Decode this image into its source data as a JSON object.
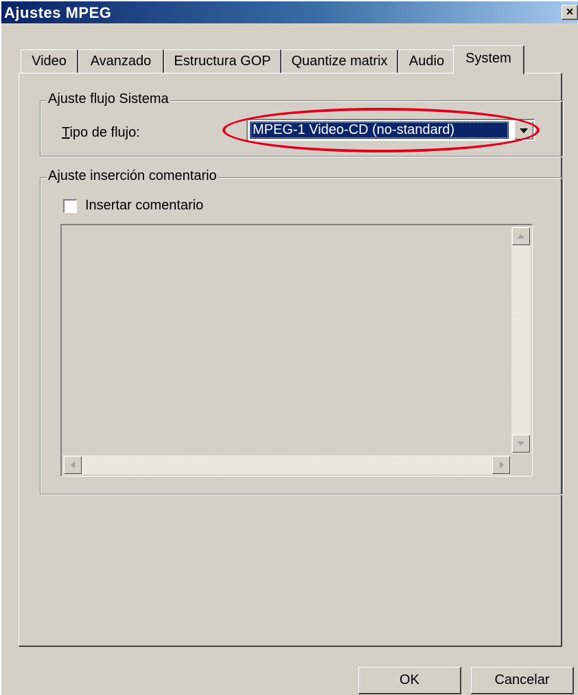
{
  "window": {
    "title": "Ajustes MPEG",
    "close_glyph": "×",
    "close_icon": "close-icon"
  },
  "tabs": [
    {
      "label": "Video",
      "active": false
    },
    {
      "label": "Avanzado",
      "active": false
    },
    {
      "label": "Estructura GOP",
      "active": false
    },
    {
      "label": "Quantize matrix",
      "active": false
    },
    {
      "label": "Audio",
      "active": false
    },
    {
      "label": "System",
      "active": true
    }
  ],
  "system_stream": {
    "group_label": "Ajuste flujo Sistema",
    "stream_type_label_accel": "T",
    "stream_type_label_rest": "ipo de flujo:",
    "stream_type_value": "MPEG-1 Video-CD (no-standard)"
  },
  "comment": {
    "group_label": "Ajuste inserción comentario",
    "checkbox_label": "Insertar comentario",
    "checked": false,
    "text": ""
  },
  "buttons": {
    "ok": "OK",
    "cancel": "Cancelar"
  },
  "colors": {
    "face": "#d4d0c8",
    "selection": "#0a246a",
    "highlight_annotation": "#e3001b"
  }
}
